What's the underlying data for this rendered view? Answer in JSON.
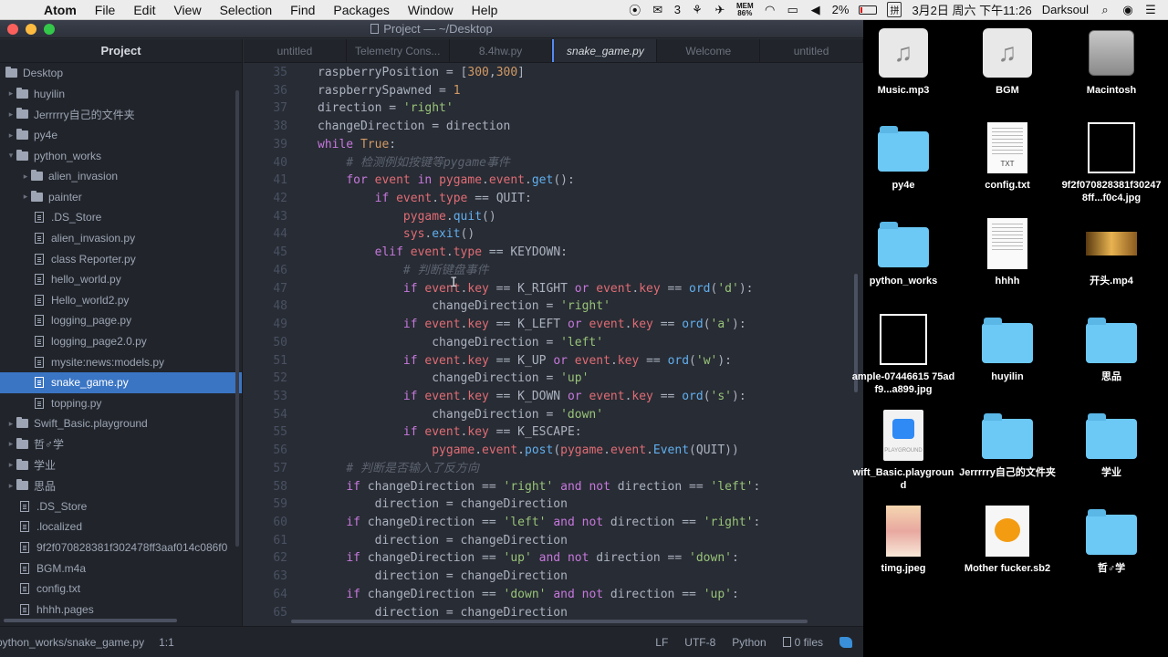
{
  "menubar": {
    "app_name": "Atom",
    "menus": [
      "File",
      "Edit",
      "View",
      "Selection",
      "Find",
      "Packages",
      "Window",
      "Help"
    ],
    "wechat_count": "3",
    "mem_label": "MEM",
    "mem_value": "86%",
    "battery": "2%",
    "clock": "3月2日 周六 下午11:26",
    "user": "Darksoul"
  },
  "window": {
    "title": "Project — ~/Desktop"
  },
  "tree": {
    "header": "Project",
    "root": "Desktop",
    "items": [
      {
        "label": "huyilin",
        "type": "folder",
        "depth": 1,
        "expanded": false
      },
      {
        "label": "Jerrrrry自己的文件夹",
        "type": "folder",
        "depth": 1,
        "expanded": false
      },
      {
        "label": "py4e",
        "type": "folder",
        "depth": 1,
        "expanded": false
      },
      {
        "label": "python_works",
        "type": "folder",
        "depth": 1,
        "expanded": true
      },
      {
        "label": "alien_invasion",
        "type": "folder",
        "depth": 2,
        "expanded": false
      },
      {
        "label": "painter",
        "type": "folder",
        "depth": 2,
        "expanded": false
      },
      {
        "label": ".DS_Store",
        "type": "file",
        "depth": 2
      },
      {
        "label": "alien_invasion.py",
        "type": "file",
        "depth": 2
      },
      {
        "label": "class Reporter.py",
        "type": "file",
        "depth": 2
      },
      {
        "label": "hello_world.py",
        "type": "file",
        "depth": 2
      },
      {
        "label": "Hello_world2.py",
        "type": "file",
        "depth": 2
      },
      {
        "label": "logging_page.py",
        "type": "file",
        "depth": 2
      },
      {
        "label": "logging_page2.0.py",
        "type": "file",
        "depth": 2
      },
      {
        "label": "mysite:news:models.py",
        "type": "file",
        "depth": 2
      },
      {
        "label": "snake_game.py",
        "type": "file",
        "depth": 2,
        "selected": true
      },
      {
        "label": "topping.py",
        "type": "file",
        "depth": 2
      },
      {
        "label": "Swift_Basic.playground",
        "type": "folder",
        "depth": 1,
        "expanded": false
      },
      {
        "label": "哲♂学",
        "type": "folder",
        "depth": 1,
        "expanded": false
      },
      {
        "label": "学业",
        "type": "folder",
        "depth": 1,
        "expanded": false
      },
      {
        "label": "思品",
        "type": "folder",
        "depth": 1,
        "expanded": false
      },
      {
        "label": ".DS_Store",
        "type": "file",
        "depth": 1
      },
      {
        "label": ".localized",
        "type": "file",
        "depth": 1
      },
      {
        "label": "9f2f070828381f302478ff3aaf014c086f0",
        "type": "file",
        "depth": 1
      },
      {
        "label": "BGM.m4a",
        "type": "file",
        "depth": 1
      },
      {
        "label": "config.txt",
        "type": "file",
        "depth": 1
      },
      {
        "label": "hhhh.pages",
        "type": "file",
        "depth": 1
      }
    ]
  },
  "tabs": [
    {
      "label": "untitled",
      "active": false
    },
    {
      "label": "Telemetry Cons...",
      "active": false
    },
    {
      "label": "8.4hw.py",
      "active": false
    },
    {
      "label": "snake_game.py",
      "active": true
    },
    {
      "label": "Welcome",
      "active": false
    },
    {
      "label": "untitled",
      "active": false
    }
  ],
  "editor": {
    "lines": [
      {
        "n": "35",
        "code": "raspberryPosition = [300,300]"
      },
      {
        "n": "36",
        "code": "raspberrySpawned = 1"
      },
      {
        "n": "37",
        "code": "direction = 'right'"
      },
      {
        "n": "38",
        "code": "changeDirection = direction"
      },
      {
        "n": "39",
        "code": "while True:"
      },
      {
        "n": "40",
        "code": "    # 检测例如按键等pygame事件"
      },
      {
        "n": "41",
        "code": "    for event in pygame.event.get():"
      },
      {
        "n": "42",
        "code": "        if event.type == QUIT:"
      },
      {
        "n": "43",
        "code": "            pygame.quit()"
      },
      {
        "n": "44",
        "code": "            sys.exit()"
      },
      {
        "n": "45",
        "code": "        elif event.type == KEYDOWN:"
      },
      {
        "n": "46",
        "code": "            # 判断键盘事件"
      },
      {
        "n": "47",
        "code": "            if event.key == K_RIGHT or event.key == ord('d'):"
      },
      {
        "n": "48",
        "code": "                changeDirection = 'right'"
      },
      {
        "n": "49",
        "code": "            if event.key == K_LEFT or event.key == ord('a'):"
      },
      {
        "n": "50",
        "code": "                changeDirection = 'left'"
      },
      {
        "n": "51",
        "code": "            if event.key == K_UP or event.key == ord('w'):"
      },
      {
        "n": "52",
        "code": "                changeDirection = 'up'"
      },
      {
        "n": "53",
        "code": "            if event.key == K_DOWN or event.key == ord('s'):"
      },
      {
        "n": "54",
        "code": "                changeDirection = 'down'"
      },
      {
        "n": "55",
        "code": "            if event.key == K_ESCAPE:"
      },
      {
        "n": "56",
        "code": "                pygame.event.post(pygame.event.Event(QUIT))"
      },
      {
        "n": "57",
        "code": "    # 判断是否输入了反方向"
      },
      {
        "n": "58",
        "code": "    if changeDirection == 'right' and not direction == 'left':"
      },
      {
        "n": "59",
        "code": "        direction = changeDirection"
      },
      {
        "n": "60",
        "code": "    if changeDirection == 'left' and not direction == 'right':"
      },
      {
        "n": "61",
        "code": "        direction = changeDirection"
      },
      {
        "n": "62",
        "code": "    if changeDirection == 'up' and not direction == 'down':"
      },
      {
        "n": "63",
        "code": "        direction = changeDirection"
      },
      {
        "n": "64",
        "code": "    if changeDirection == 'down' and not direction == 'up':"
      },
      {
        "n": "65",
        "code": "        direction = changeDirection"
      }
    ]
  },
  "statusbar": {
    "path": "python_works/snake_game.py",
    "cursor": "1:1",
    "line_ending": "LF",
    "encoding": "UTF-8",
    "grammar": "Python",
    "git_files": "0 files"
  },
  "desktop": {
    "icons": [
      {
        "label": "Music.mp3",
        "kind": "music",
        "col": 0,
        "row": 0
      },
      {
        "label": "BGM",
        "kind": "music",
        "col": 1,
        "row": 0
      },
      {
        "label": "Macintosh",
        "kind": "disk",
        "col": 2,
        "row": 0
      },
      {
        "label": "py4e",
        "kind": "folder",
        "col": 0,
        "row": 1
      },
      {
        "label": "config.txt",
        "kind": "txt",
        "col": 1,
        "row": 1
      },
      {
        "label": "9f2f070828381f302478ff...f0c4.jpg",
        "kind": "blackimg",
        "col": 2,
        "row": 1
      },
      {
        "label": "python_works",
        "kind": "folder",
        "col": 0,
        "row": 2
      },
      {
        "label": "hhhh",
        "kind": "doc",
        "col": 1,
        "row": 2
      },
      {
        "label": "开头.mp4",
        "kind": "video",
        "col": 2,
        "row": 2
      },
      {
        "label": "ample-07446615 75adf9...a899.jpg",
        "kind": "blackimg",
        "col": 0,
        "row": 3
      },
      {
        "label": "huyilin",
        "kind": "folder",
        "col": 1,
        "row": 3
      },
      {
        "label": "思品",
        "kind": "folder",
        "col": 2,
        "row": 3
      },
      {
        "label": "wift_Basic.playground",
        "kind": "swift",
        "col": 0,
        "row": 4
      },
      {
        "label": "Jerrrrry自己的文件夹",
        "kind": "folder",
        "col": 1,
        "row": 4
      },
      {
        "label": "学业",
        "kind": "folder",
        "col": 2,
        "row": 4
      },
      {
        "label": "timg.jpeg",
        "kind": "photo",
        "col": 0,
        "row": 5
      },
      {
        "label": "Mother fucker.sb2",
        "kind": "scratch",
        "col": 1,
        "row": 5
      },
      {
        "label": "哲♂学",
        "kind": "folder",
        "col": 2,
        "row": 5
      }
    ]
  }
}
